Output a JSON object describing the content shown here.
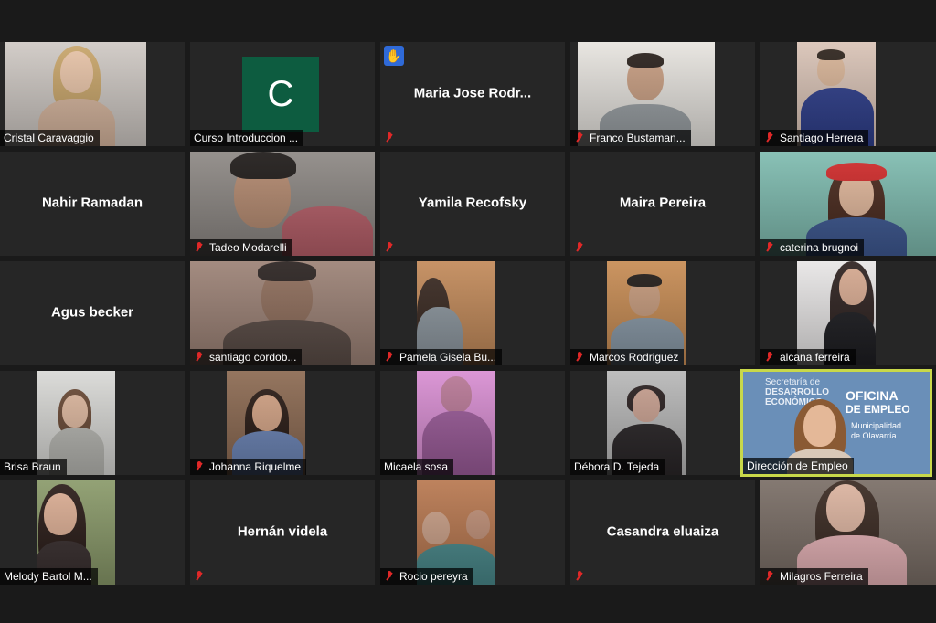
{
  "colors": {
    "background": "#1a1a1a",
    "tile": "#262626",
    "active_border": "#c8d84a",
    "muted_red": "#e02828",
    "logo_green": "#0d5c40",
    "hand_blue": "#2f6ad8"
  },
  "participants": [
    {
      "name": "Cristal Caravaggio",
      "muted": false,
      "video": true
    },
    {
      "name": "Curso Introduccion ...",
      "muted": false,
      "video": false,
      "logo_letter": "C"
    },
    {
      "name": "Maria Jose Rodr...",
      "muted": true,
      "video": false,
      "hand_raised": true,
      "hand_icon": "raised-hand-icon"
    },
    {
      "name": "Franco Bustaman...",
      "muted": true,
      "video": true
    },
    {
      "name": "Santiago Herrera",
      "muted": true,
      "video": true
    },
    {
      "name": "Nahir Ramadan",
      "muted": false,
      "video": false
    },
    {
      "name": "Tadeo Modarelli",
      "muted": true,
      "video": true
    },
    {
      "name": "Yamila Recofsky",
      "muted": true,
      "video": false
    },
    {
      "name": "Maira Pereira",
      "muted": true,
      "video": false
    },
    {
      "name": "caterina brugnoi",
      "muted": true,
      "video": true
    },
    {
      "name": "Agus becker",
      "muted": false,
      "video": false
    },
    {
      "name": "santiago cordob...",
      "muted": true,
      "video": true
    },
    {
      "name": "Pamela Gisela Bu...",
      "muted": true,
      "video": true
    },
    {
      "name": "Marcos Rodriguez",
      "muted": true,
      "video": true
    },
    {
      "name": "alcana ferreira",
      "muted": true,
      "video": true
    },
    {
      "name": "Brisa Braun",
      "muted": false,
      "video": true
    },
    {
      "name": "Johanna Riquelme",
      "muted": true,
      "video": true
    },
    {
      "name": "Micaela sosa",
      "muted": false,
      "video": true
    },
    {
      "name": "Débora D. Tejeda",
      "muted": false,
      "video": true
    },
    {
      "name": "Dirección de Empleo",
      "muted": false,
      "video": true,
      "active_speaker": true,
      "background_text": {
        "line1": "Secretaría de",
        "line2": "DESARROLLO",
        "line3": "ECONÓMICO",
        "line4": "OFICINA",
        "line5": "DE EMPLEO",
        "line6": "Municipalidad",
        "line7": "de Olavarría"
      }
    },
    {
      "name": "Melody Bartol M...",
      "muted": false,
      "video": true
    },
    {
      "name": "Hernán videla",
      "muted": true,
      "video": false
    },
    {
      "name": "Rocio pereyra",
      "muted": true,
      "video": true
    },
    {
      "name": "Casandra eluaiza",
      "muted": true,
      "video": false
    },
    {
      "name": "Milagros Ferreira",
      "muted": true,
      "video": true
    }
  ]
}
